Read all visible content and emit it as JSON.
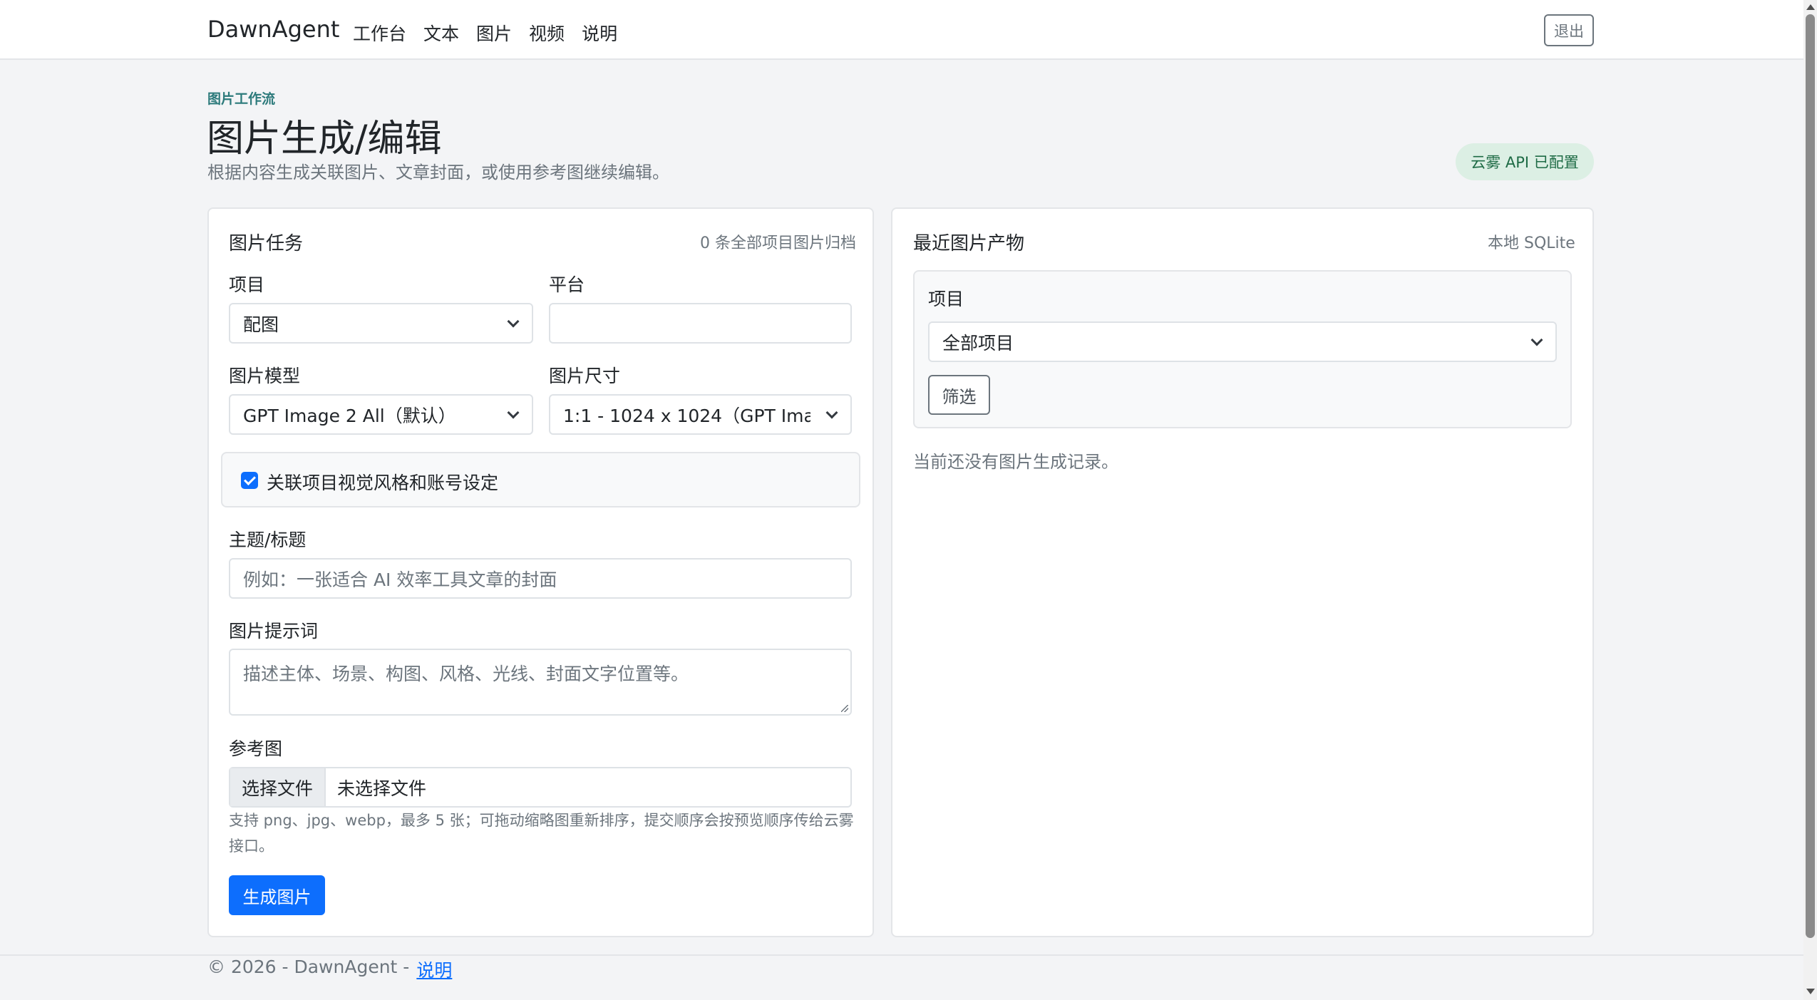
{
  "nav": {
    "brand": "DawnAgent",
    "links": [
      "工作台",
      "文本",
      "图片",
      "视频",
      "说明"
    ],
    "logout_label": "退出"
  },
  "header": {
    "eyebrow": "图片工作流",
    "title": "图片生成/编辑",
    "subtitle": "根据内容生成关联图片、文章封面，或使用参考图继续编辑。",
    "status_badge": "云雾 API 已配置"
  },
  "task_card": {
    "title": "图片任务",
    "meta": "0 条全部项目图片归档",
    "project_label": "项目",
    "project_value": "配图",
    "platform_label": "平台",
    "platform_value": "",
    "model_label": "图片模型",
    "model_value": "GPT Image 2 All（默认）",
    "size_label": "图片尺寸",
    "size_value": "1:1 - 1024 x 1024（GPT Image",
    "link_style_label": "关联项目视觉风格和账号设定",
    "link_style_checked": true,
    "topic_label": "主题/标题",
    "topic_placeholder": "例如：一张适合 AI 效率工具文章的封面",
    "prompt_label": "图片提示词",
    "prompt_placeholder": "描述主体、场景、构图、风格、光线、封面文字位置等。",
    "reference_label": "参考图",
    "choose_file_label": "选择文件",
    "no_file_label": "未选择文件",
    "reference_help": "支持 png、jpg、webp，最多 5 张；可拖动缩略图重新排序，提交顺序会按预览顺序传给云雾接口。",
    "generate_label": "生成图片"
  },
  "recent_card": {
    "title": "最近图片产物",
    "meta": "本地 SQLite",
    "filter_project_label": "项目",
    "filter_project_value": "全部项目",
    "filter_label": "筛选",
    "empty_text": "当前还没有图片生成记录。"
  },
  "footer": {
    "copyright": "© 2026 - DawnAgent -",
    "link": "说明"
  }
}
